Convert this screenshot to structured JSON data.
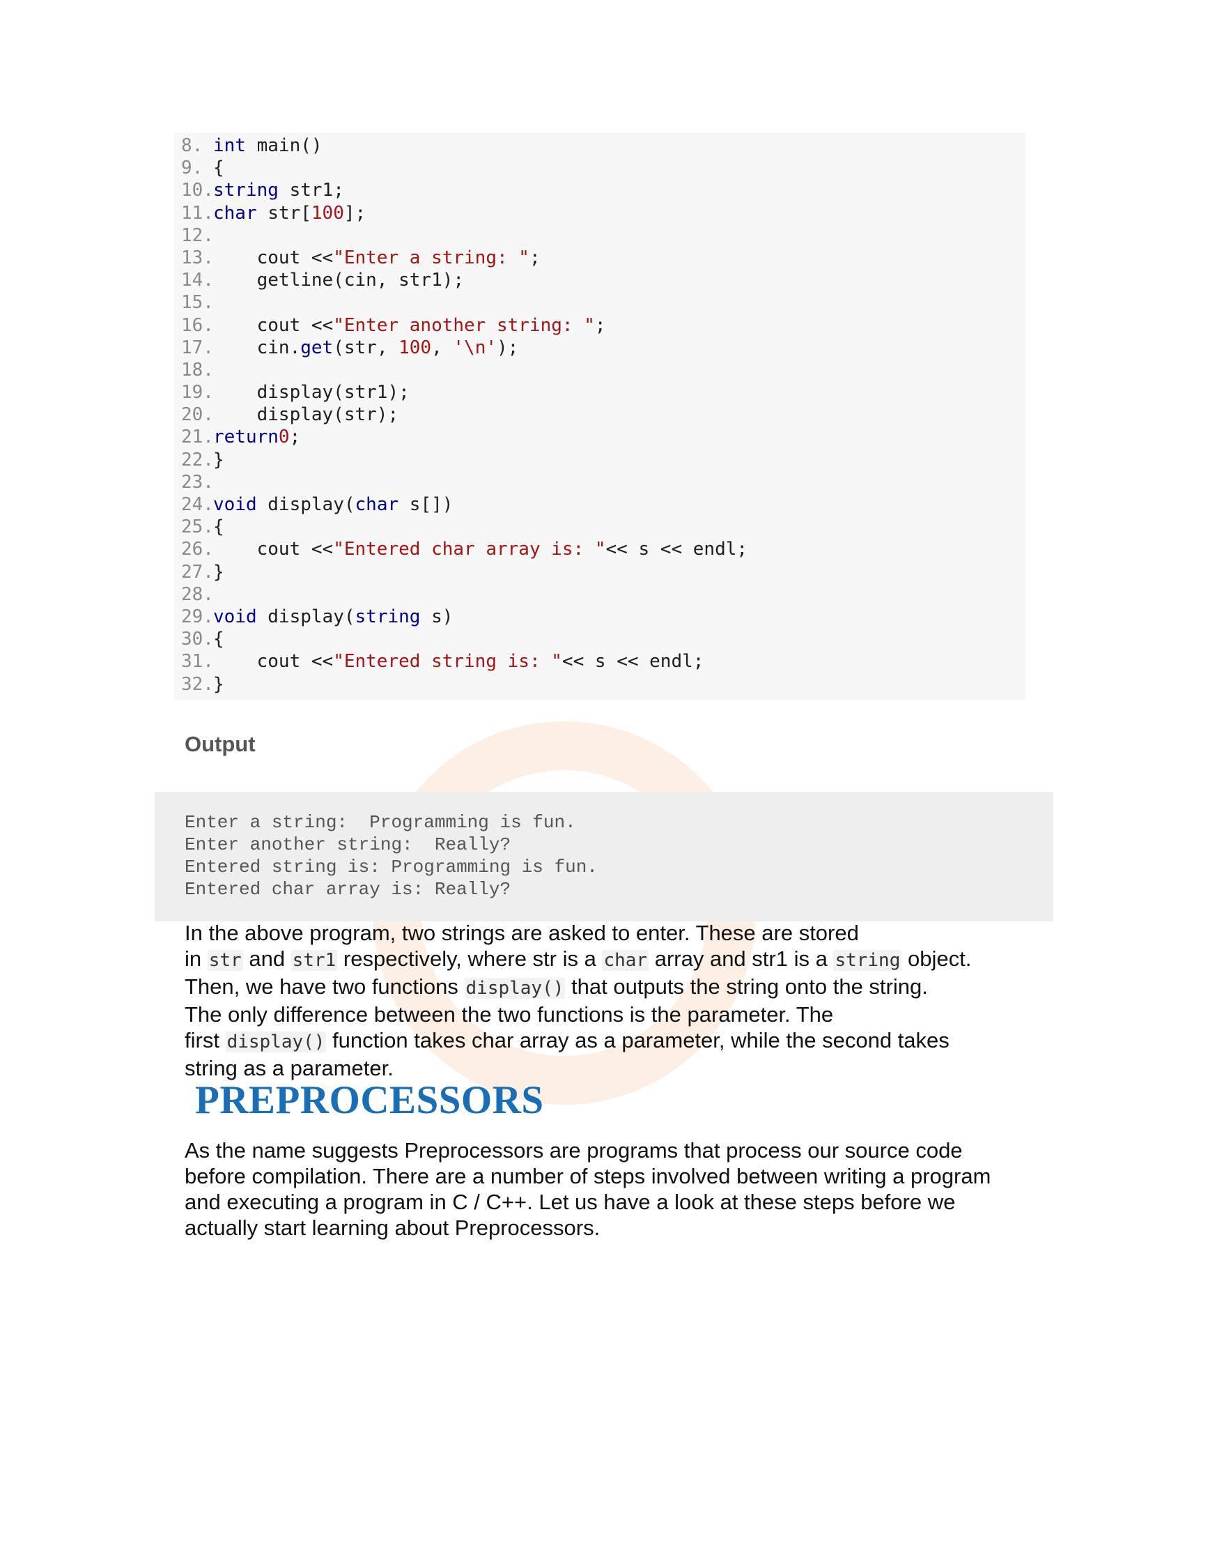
{
  "code": {
    "lines": [
      {
        "n": "8.",
        "t": [
          {
            "k": "kw",
            "v": "int"
          },
          {
            "k": "code",
            "v": " main()"
          }
        ]
      },
      {
        "n": "9.",
        "t": [
          {
            "k": "code",
            "v": "{"
          }
        ]
      },
      {
        "n": "10.",
        "t": [
          {
            "k": "kw",
            "v": "string"
          },
          {
            "k": "code",
            "v": " str1;"
          }
        ]
      },
      {
        "n": "11.",
        "t": [
          {
            "k": "kw",
            "v": "char"
          },
          {
            "k": "code",
            "v": " str["
          },
          {
            "k": "num",
            "v": "100"
          },
          {
            "k": "code",
            "v": "];"
          }
        ]
      },
      {
        "n": "12.",
        "t": []
      },
      {
        "n": "13.",
        "t": [
          {
            "k": "code",
            "v": "    cout <<"
          },
          {
            "k": "str",
            "v": "\"Enter a string: \""
          },
          {
            "k": "code",
            "v": ";"
          }
        ]
      },
      {
        "n": "14.",
        "t": [
          {
            "k": "code",
            "v": "    getline(cin, str1);"
          }
        ]
      },
      {
        "n": "15.",
        "t": []
      },
      {
        "n": "16.",
        "t": [
          {
            "k": "code",
            "v": "    cout <<"
          },
          {
            "k": "str",
            "v": "\"Enter another string: \""
          },
          {
            "k": "code",
            "v": ";"
          }
        ]
      },
      {
        "n": "17.",
        "t": [
          {
            "k": "code",
            "v": "    cin."
          },
          {
            "k": "kw",
            "v": "get"
          },
          {
            "k": "code",
            "v": "(str, "
          },
          {
            "k": "num",
            "v": "100"
          },
          {
            "k": "code",
            "v": ", "
          },
          {
            "k": "str",
            "v": "'\\n'"
          },
          {
            "k": "code",
            "v": ");"
          }
        ]
      },
      {
        "n": "18.",
        "t": []
      },
      {
        "n": "19.",
        "t": [
          {
            "k": "code",
            "v": "    display(str1);"
          }
        ]
      },
      {
        "n": "20.",
        "t": [
          {
            "k": "code",
            "v": "    display(str);"
          }
        ]
      },
      {
        "n": "21.",
        "t": [
          {
            "k": "kw",
            "v": "return"
          },
          {
            "k": "num",
            "v": "0"
          },
          {
            "k": "code",
            "v": ";"
          }
        ]
      },
      {
        "n": "22.",
        "t": [
          {
            "k": "code",
            "v": "}"
          }
        ]
      },
      {
        "n": "23.",
        "t": []
      },
      {
        "n": "24.",
        "t": [
          {
            "k": "kw",
            "v": "void"
          },
          {
            "k": "code",
            "v": " display("
          },
          {
            "k": "kw",
            "v": "char"
          },
          {
            "k": "code",
            "v": " s[])"
          }
        ]
      },
      {
        "n": "25.",
        "t": [
          {
            "k": "code",
            "v": "{"
          }
        ]
      },
      {
        "n": "26.",
        "t": [
          {
            "k": "code",
            "v": "    cout <<"
          },
          {
            "k": "str",
            "v": "\"Entered char array is: \""
          },
          {
            "k": "code",
            "v": "<< s << endl;"
          }
        ]
      },
      {
        "n": "27.",
        "t": [
          {
            "k": "code",
            "v": "}"
          }
        ]
      },
      {
        "n": "28.",
        "t": []
      },
      {
        "n": "29.",
        "t": [
          {
            "k": "kw",
            "v": "void"
          },
          {
            "k": "code",
            "v": " display("
          },
          {
            "k": "kw",
            "v": "string"
          },
          {
            "k": "code",
            "v": " s)"
          }
        ]
      },
      {
        "n": "30.",
        "t": [
          {
            "k": "code",
            "v": "{"
          }
        ]
      },
      {
        "n": "31.",
        "t": [
          {
            "k": "code",
            "v": "    cout <<"
          },
          {
            "k": "str",
            "v": "\"Entered string is: \""
          },
          {
            "k": "code",
            "v": "<< s << endl;"
          }
        ]
      },
      {
        "n": "32.",
        "t": [
          {
            "k": "code",
            "v": "}"
          }
        ]
      }
    ]
  },
  "output": {
    "heading": "Output",
    "lines": [
      "Enter a string:  Programming is fun.",
      "Enter another string:  Really?",
      "Entered string is: Programming is fun.",
      "Entered char array is: Really?"
    ]
  },
  "explanation": {
    "l1": "In the above program, two strings are asked to enter. These are stored",
    "l2_a": "in ",
    "l2_c1": "str",
    "l2_b": " and ",
    "l2_c2": "str1",
    "l2_c": " respectively, where str is a ",
    "l2_c3": "char",
    "l2_d": " array and str1 is a ",
    "l2_c4": "string",
    "l2_e": " object.",
    "l3_a": "Then, we have two functions ",
    "l3_c": "display()",
    "l3_b": " that outputs the string onto the string.",
    "l4": "The only difference between the two functions is the parameter. The",
    "l5_a": "first ",
    "l5_c": "display()",
    "l5_b": " function takes char array as a parameter, while the second takes",
    "l6": "string as a parameter."
  },
  "section": {
    "title": "PREPROCESSORS",
    "p1": "As the name suggests Preprocessors are programs that process our source code",
    "p2": "before compilation. There are a number of steps involved between writing a program",
    "p3": "and executing a program in C / C++. Let us have a look at these steps before we",
    "p4": "actually start learning about Preprocessors."
  },
  "colors": {
    "keyword": "#00008b",
    "string": "#a31515",
    "title": "#1a6eb5",
    "watermark": "#f08020"
  }
}
